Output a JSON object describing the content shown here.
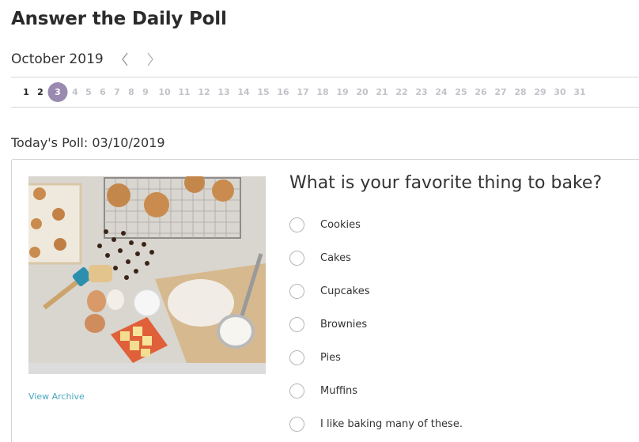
{
  "header": {
    "title": "Answer the Daily Poll"
  },
  "calendar": {
    "month_label": "October 2019",
    "prev_icon": "chevron-left-icon",
    "next_icon": "chevron-right-icon",
    "selected_day": "3",
    "days": [
      {
        "label": "1",
        "state": "active"
      },
      {
        "label": "2",
        "state": "active"
      },
      {
        "label": "3",
        "state": "selected"
      },
      {
        "label": "4",
        "state": "future"
      },
      {
        "label": "5",
        "state": "future"
      },
      {
        "label": "6",
        "state": "future"
      },
      {
        "label": "7",
        "state": "future"
      },
      {
        "label": "8",
        "state": "future"
      },
      {
        "label": "9",
        "state": "future"
      },
      {
        "label": "10",
        "state": "future"
      },
      {
        "label": "11",
        "state": "future"
      },
      {
        "label": "12",
        "state": "future"
      },
      {
        "label": "13",
        "state": "future"
      },
      {
        "label": "14",
        "state": "future"
      },
      {
        "label": "15",
        "state": "future"
      },
      {
        "label": "16",
        "state": "future"
      },
      {
        "label": "17",
        "state": "future"
      },
      {
        "label": "18",
        "state": "future"
      },
      {
        "label": "19",
        "state": "future"
      },
      {
        "label": "20",
        "state": "future"
      },
      {
        "label": "21",
        "state": "future"
      },
      {
        "label": "22",
        "state": "future"
      },
      {
        "label": "23",
        "state": "future"
      },
      {
        "label": "24",
        "state": "future"
      },
      {
        "label": "25",
        "state": "future"
      },
      {
        "label": "26",
        "state": "future"
      },
      {
        "label": "27",
        "state": "future"
      },
      {
        "label": "28",
        "state": "future"
      },
      {
        "label": "29",
        "state": "future"
      },
      {
        "label": "30",
        "state": "future"
      },
      {
        "label": "31",
        "state": "future"
      }
    ]
  },
  "poll": {
    "date_label": "Today's Poll: 03/10/2019",
    "question": "What is your favorite thing to bake?",
    "archive_link": "View Archive",
    "options": [
      "Cookies",
      "Cakes",
      "Cupcakes",
      "Brownies",
      "Pies",
      "Muffins",
      "I like baking many of these."
    ]
  },
  "colors": {
    "selected_day_bg": "#9a8ab0",
    "link": "#4aa8c0",
    "inactive_day": "#c2c2c8"
  }
}
